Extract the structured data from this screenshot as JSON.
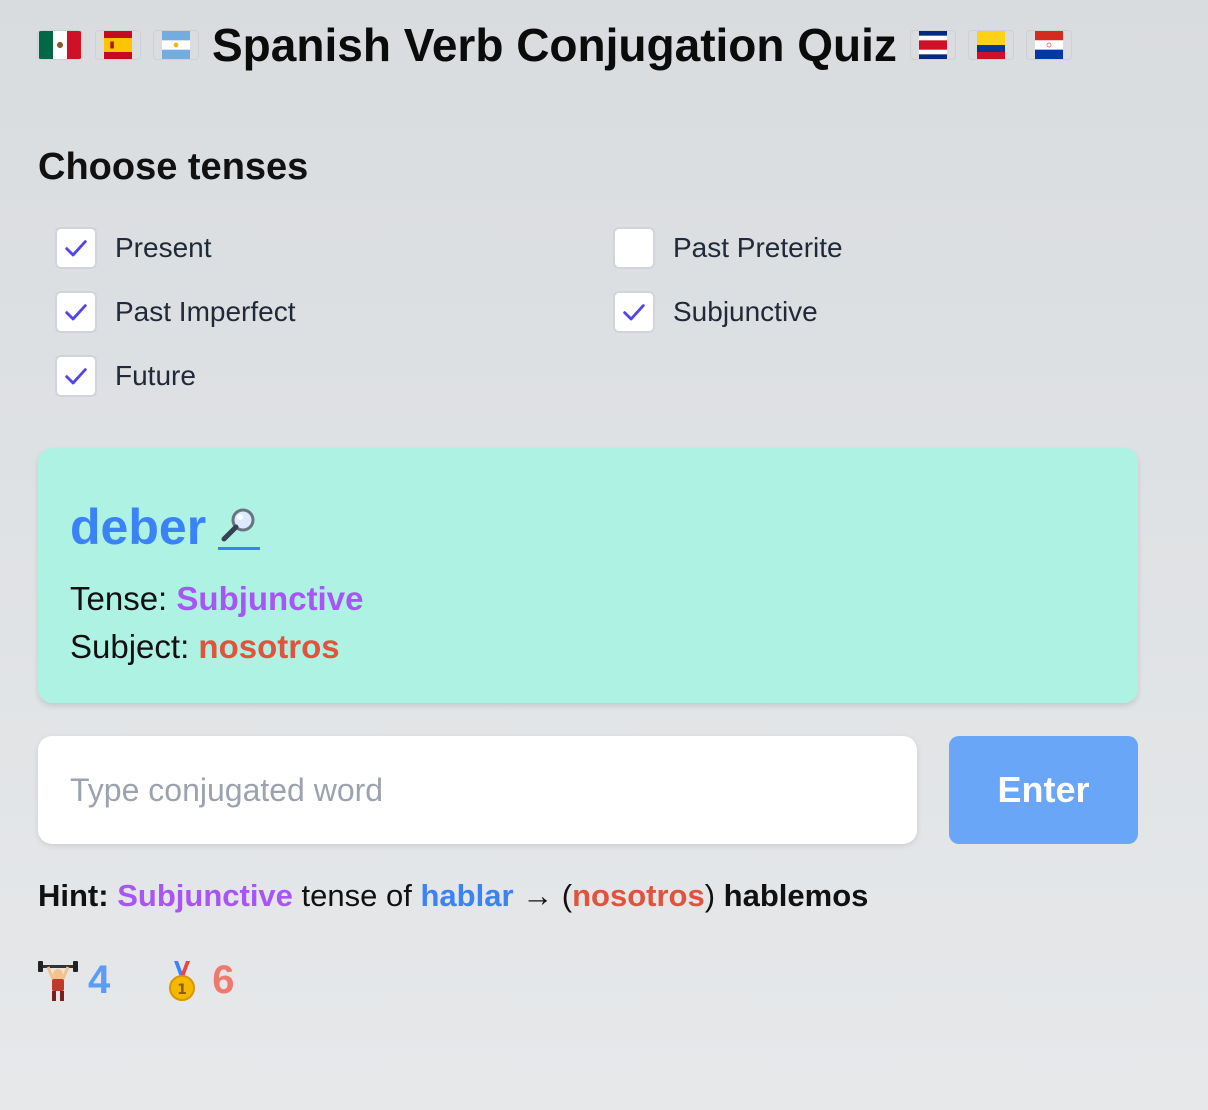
{
  "header": {
    "title": "Spanish Verb Conjugation Quiz",
    "flags_left": [
      "mexico-flag-icon",
      "spain-flag-icon",
      "argentina-flag-icon"
    ],
    "flags_right": [
      "costa-rica-flag-icon",
      "colombia-flag-icon",
      "paraguay-flag-icon"
    ]
  },
  "tenses": {
    "heading": "Choose tenses",
    "items": [
      {
        "label": "Present",
        "checked": true
      },
      {
        "label": "Past Preterite",
        "checked": false
      },
      {
        "label": "Past Imperfect",
        "checked": true
      },
      {
        "label": "Subjunctive",
        "checked": true
      },
      {
        "label": "Future",
        "checked": true
      }
    ]
  },
  "question": {
    "verb": "deber",
    "lookup_icon": "magnifying-glass-icon",
    "tense_label": "Tense:",
    "tense_value": "Subjunctive",
    "subject_label": "Subject:",
    "subject_value": "nosotros"
  },
  "answer": {
    "placeholder": "Type conjugated word",
    "value": "",
    "enter_label": "Enter"
  },
  "hint": {
    "label": "Hint:",
    "tense": "Subjunctive",
    "text_mid": "tense of",
    "verb": "hablar",
    "arrow": "→",
    "open_paren": "(",
    "subject": "nosotros",
    "close_paren": ")",
    "answer": "hablemos"
  },
  "stats": {
    "streak_icon": "weightlifter-icon",
    "streak": "4",
    "best_icon": "gold-medal-icon",
    "best": "6"
  },
  "colors": {
    "card_bg": "#aef2e3",
    "verb": "#3b82f6",
    "tense": "#a855f7",
    "subject": "#e0533d",
    "enter_button": "#6aa6f8"
  }
}
